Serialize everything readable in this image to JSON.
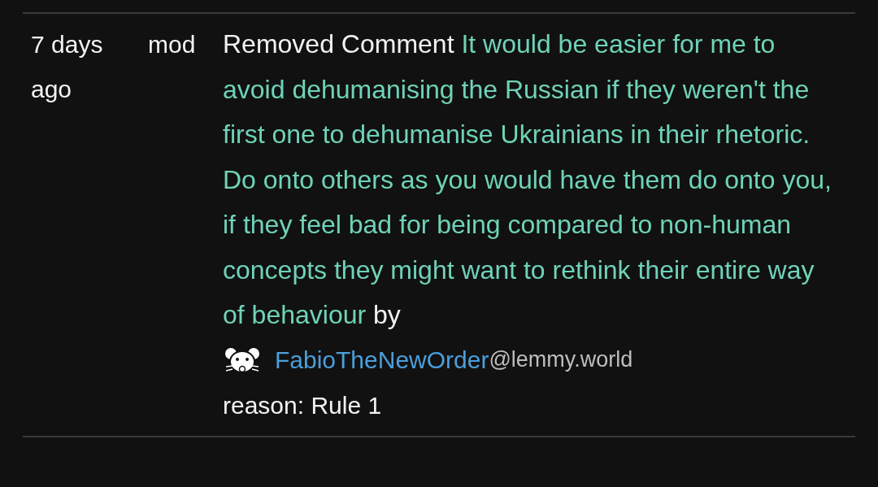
{
  "entries": [
    {
      "time": "7 days ago",
      "moderator": "mod",
      "action": "Removed Comment",
      "comment": "It would be easier for me to avoid dehumanising the Russian if they weren't the first one to dehumanise Ukrainians in their rhetoric. Do onto others as you would have them do onto you, if they feel bad for being compared to non-human concepts they might want to rethink their entire way of behaviour",
      "by": "by",
      "user": {
        "name": "FabioTheNewOrder",
        "instance": "@lemmy.world"
      },
      "reason": "reason: Rule 1"
    }
  ]
}
